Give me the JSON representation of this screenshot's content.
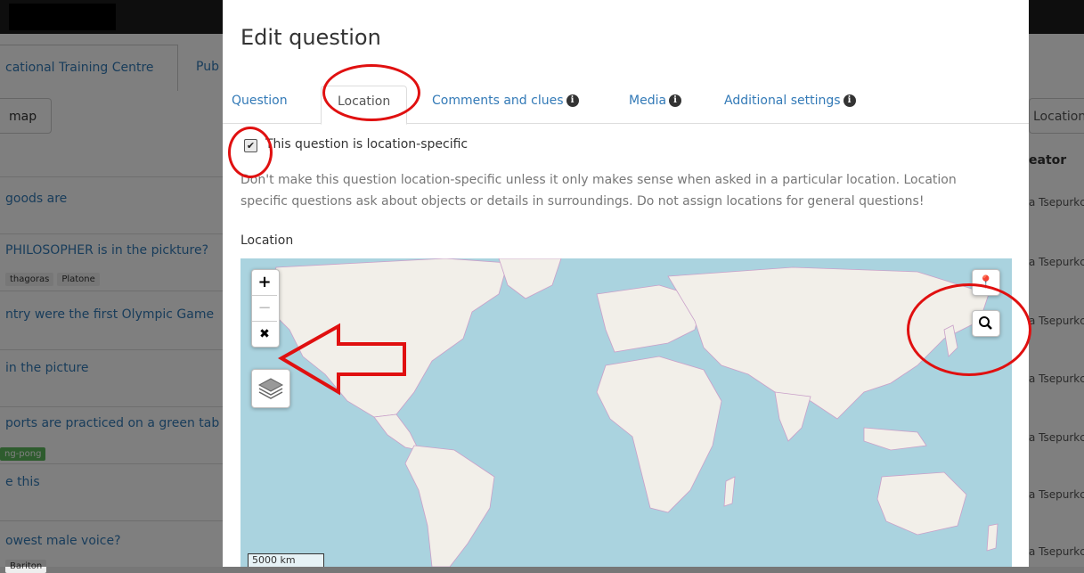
{
  "background": {
    "tab_training": "cational Training Centre",
    "tab_public": "Pub",
    "map_button": "map",
    "questions": [
      {
        "text": "goods are",
        "tags": []
      },
      {
        "text": "PHILOSOPHER is in the pickture?",
        "tags": [
          "thagoras",
          "Platone"
        ]
      },
      {
        "text": "ntry were the first Olympic Game",
        "tags": []
      },
      {
        "text": "in the picture",
        "tags": []
      },
      {
        "text": "ports are practiced on a green tab",
        "tags": [
          "ng-pong"
        ]
      },
      {
        "text": "e this",
        "tags": []
      },
      {
        "text": "owest male voice?",
        "tags": [
          "Bariton"
        ]
      }
    ],
    "right_header": "Location",
    "right_col": "eator",
    "right_names": [
      "a Tsepurkc",
      "a Tsepurkc",
      "a Tsepurkc",
      "a Tsepurkc",
      "a Tsepurkc",
      "a Tsepurkc",
      "a Tsepurkc"
    ]
  },
  "modal": {
    "title": "Edit question",
    "tabs": [
      {
        "label": "Question"
      },
      {
        "label": "Location"
      },
      {
        "label": "Comments and clues"
      },
      {
        "label": "Media"
      },
      {
        "label": "Additional settings"
      }
    ],
    "info_glyph": "i",
    "checkbox_label": "This question is location-specific",
    "checkbox_checked": true,
    "help_text": "Don't make this question location-specific unless it only makes sense when asked in a particular location. Location specific questions ask about objects or details in surroundings. Do not assign locations for general questions!",
    "location_label": "Location",
    "map": {
      "zoom_in": "+",
      "zoom_out": "−",
      "scale": "5000 km"
    }
  },
  "colors": {
    "link": "#337ab7",
    "annotation": "#e01010",
    "water": "#aad3df",
    "land": "#f2efe9"
  }
}
